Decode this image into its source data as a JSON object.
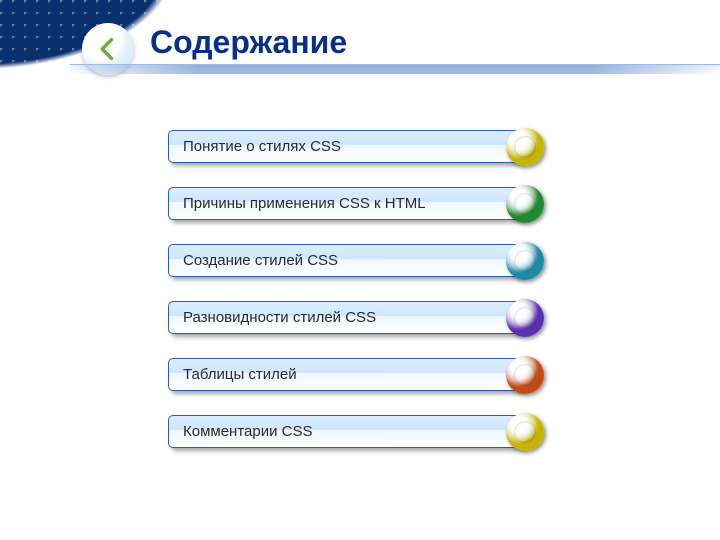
{
  "title": "Содержание",
  "toc": {
    "items": [
      {
        "label": "Понятие о стилях CSS",
        "color": "#c7b400"
      },
      {
        "label": "Причины применения CSS к HTML",
        "color": "#1f8a2e"
      },
      {
        "label": "Создание стилей CSS",
        "color": "#1f8aa6"
      },
      {
        "label": "Разновидности стилей CSS",
        "color": "#5a2fb0"
      },
      {
        "label": "Таблицы стилей",
        "color": "#c24a14"
      },
      {
        "label": "Комментарии CSS",
        "color": "#c7b400"
      }
    ]
  }
}
